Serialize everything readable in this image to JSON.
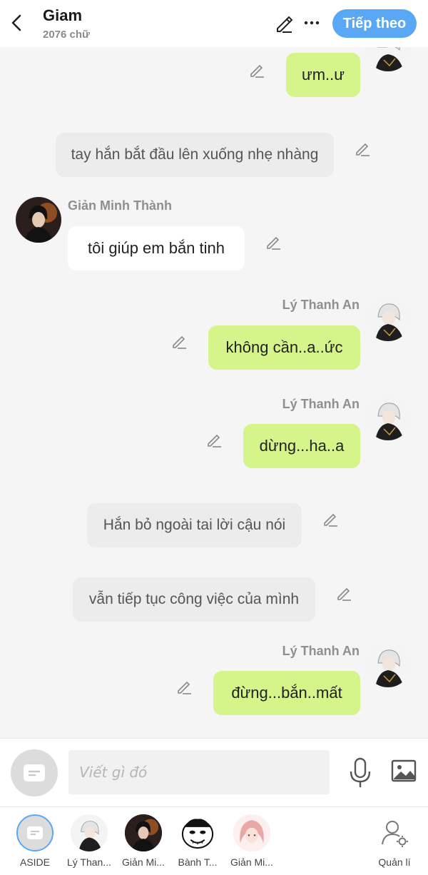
{
  "header": {
    "title": "Giam",
    "word_count": "2076 chữ",
    "next_label": "Tiếp theo"
  },
  "messages": [
    {
      "kind": "right",
      "text": "ưm..ư"
    },
    {
      "kind": "narration",
      "text": "tay hắn bắt đầu lên xuống nhẹ nhàng"
    },
    {
      "kind": "left",
      "sender": "Giản Minh Thành",
      "text": "tôi giúp em bắn tinh"
    },
    {
      "kind": "right",
      "sender": "Lý Thanh An",
      "text": "không cần..a..ức"
    },
    {
      "kind": "right",
      "sender": "Lý Thanh An",
      "text": "dừng...ha..a"
    },
    {
      "kind": "narration",
      "text": "Hắn bỏ ngoài tai lời cậu nói"
    },
    {
      "kind": "narration",
      "text": "vẫn tiếp tục công việc của mình"
    },
    {
      "kind": "right",
      "sender": "Lý Thanh An",
      "text": "đừng...bắn..mất"
    }
  ],
  "input": {
    "placeholder": "Viết gì đó"
  },
  "characters": [
    {
      "name": "ASIDE"
    },
    {
      "name": "Lý Than..."
    },
    {
      "name": "Giản Mi..."
    },
    {
      "name": "Bành T..."
    },
    {
      "name": "Giản Mi..."
    },
    {
      "name": "Quản lí"
    }
  ],
  "colors": {
    "accent": "#5aa8f5",
    "right_bubble": "#d5f58a",
    "narration_bubble": "#ececec",
    "background": "#f5f5f5"
  }
}
